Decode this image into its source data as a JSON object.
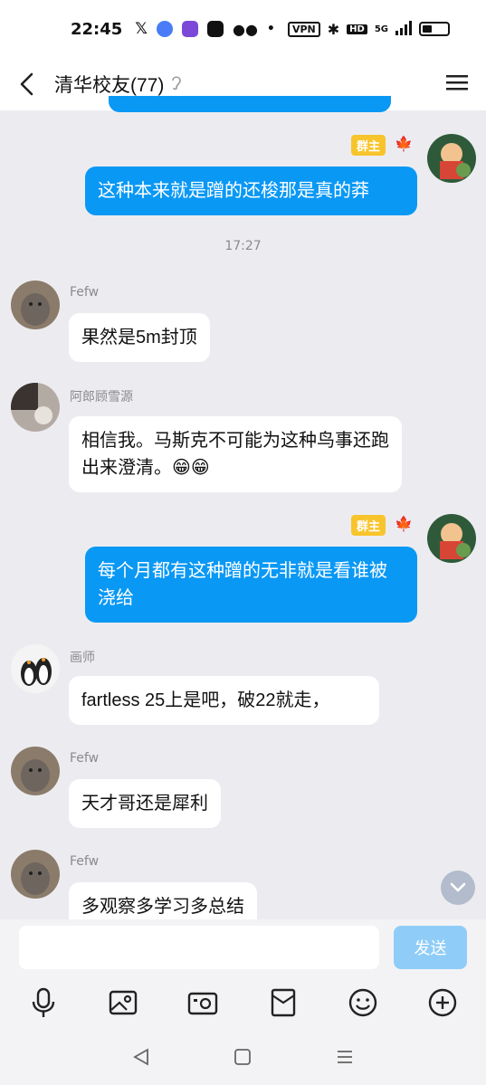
{
  "status_bar": {
    "time": "22:45",
    "vpn": "VPN",
    "hd": "HD",
    "network": "5G"
  },
  "header": {
    "title": "清华校友(77)"
  },
  "chat": {
    "timestamp": "17:27",
    "owner_badge": "群主",
    "messages": [
      {
        "sender": "self",
        "text": "这种本来就是蹭的还梭那是真的莽"
      },
      {
        "sender": "Fefw",
        "text": "果然是5m封顶"
      },
      {
        "sender": "阿郎顾雪源",
        "text": "相信我。马斯克不可能为这种鸟事还跑出来澄清。😁😁"
      },
      {
        "sender": "self",
        "text": "每个月都有这种蹭的无非就是看谁被浇给"
      },
      {
        "sender": "画师",
        "text": "fartless 25上是吧，破22就走，"
      },
      {
        "sender": "Fefw",
        "text": "天才哥还是犀利"
      },
      {
        "sender": "Fefw",
        "text": "多观察多学习多总结"
      }
    ]
  },
  "input": {
    "value": "",
    "send_label": "发送"
  },
  "toolbar": {
    "icons": [
      "microphone-icon",
      "image-icon",
      "camera-icon",
      "red-packet-icon",
      "emoji-icon",
      "plus-icon"
    ]
  },
  "colors": {
    "outgoing_bubble": "#0a98f5",
    "incoming_bubble": "#ffffff",
    "background": "#ececf0",
    "owner_badge": "#f8c42c",
    "send_button": "#8fcdf8"
  }
}
